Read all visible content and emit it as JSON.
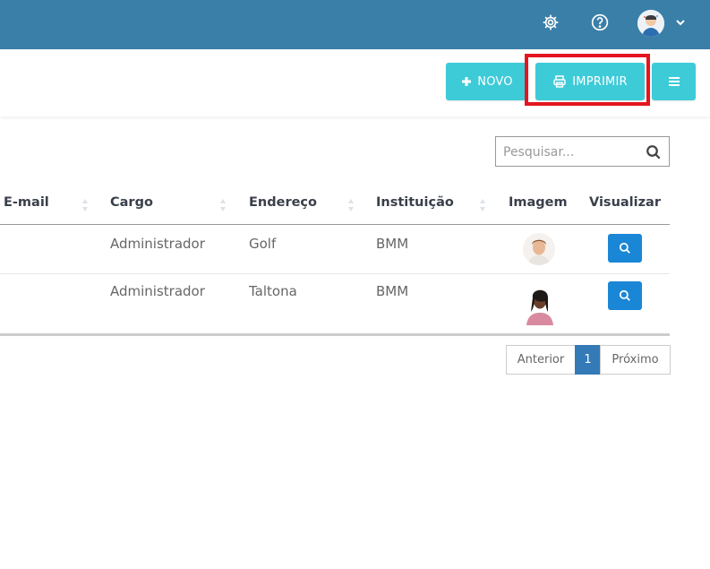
{
  "topbar": {
    "icons": [
      "gear-icon",
      "help-circle-icon",
      "user-avatar",
      "chevron-down-icon"
    ],
    "color": "#3a7fa8"
  },
  "toolbar": {
    "new_label": "NOVO",
    "print_label": "IMPRIMIR",
    "accent": "#3ecbd8",
    "highlight_color": "#e4151f"
  },
  "search": {
    "placeholder": "Pesquisar..."
  },
  "table": {
    "columns": [
      "E-mail",
      "Cargo",
      "Endereço",
      "Instituição",
      "Imagem",
      "Visualizar"
    ],
    "rows": [
      {
        "cargo": "Administrador",
        "endereco": "Golf",
        "instituicao": "BMM"
      },
      {
        "cargo": "Administrador",
        "endereco": "Taltona",
        "instituicao": "BMM"
      }
    ]
  },
  "pagination": {
    "prev": "Anterior",
    "current": "1",
    "next": "Próximo",
    "active_color": "#337ab7"
  }
}
